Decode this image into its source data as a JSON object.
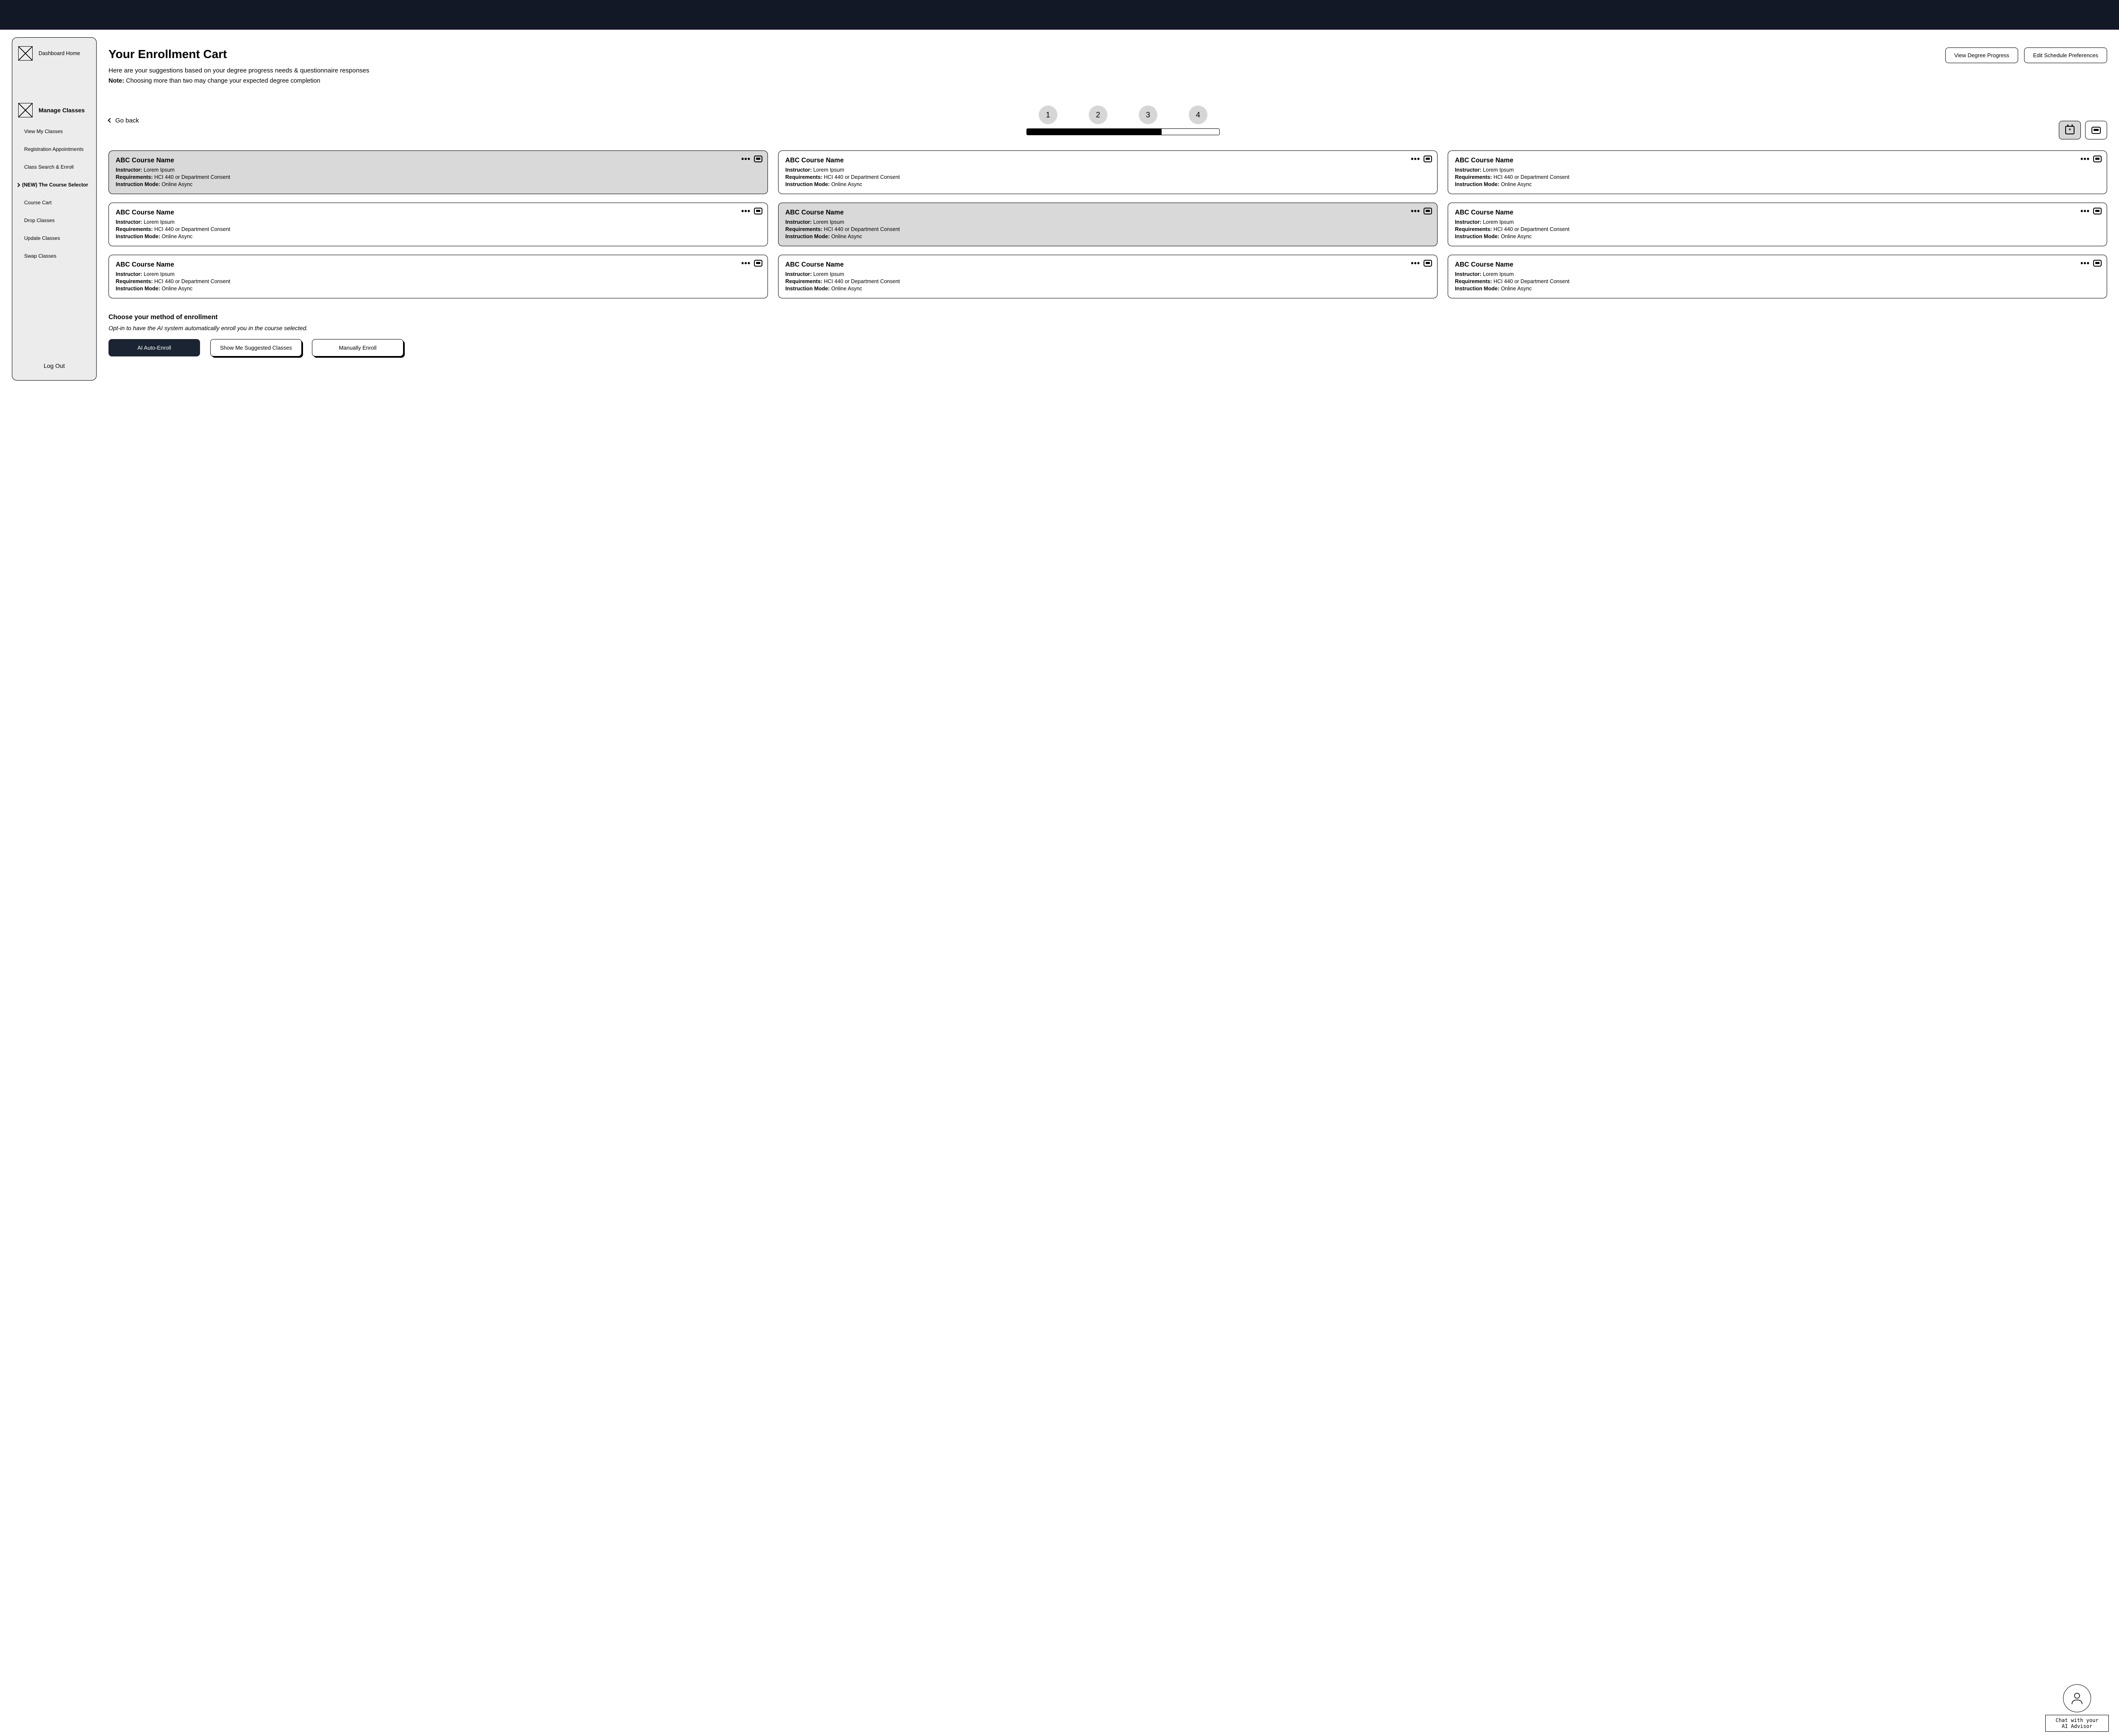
{
  "sidebar": {
    "dashboard_label": "Dashboard Home",
    "manage_label": "Manage Classes",
    "items": [
      "View My Classes",
      "Registration Appointments",
      "Class Search & Enroll",
      "(NEW) The Course Selector",
      "Course Cart",
      "Drop Classes",
      "Update Classes",
      "Swap Classes"
    ],
    "logout_label": "Log Out"
  },
  "header": {
    "title": "Your Enrollment Cart",
    "subtitle": "Here are your suggestions based on your degree progress needs & questionnaire responses",
    "note_label": "Note:",
    "note_text": "Choosing more than two may change your expected degree completion",
    "btn_degree": "View Degree Progress",
    "btn_prefs": "Edit Schedule Preferences"
  },
  "steps": {
    "go_back": "Go back",
    "labels": [
      "1",
      "2",
      "3",
      "4"
    ],
    "progress_percent": 70
  },
  "cards": [
    {
      "title": "ABC Course Name",
      "instructor_label": "Instructor:",
      "instructor": "Lorem Ipsum",
      "req_label": "Requirements:",
      "req": "HCI 440 or Department Consent",
      "mode_label": "Instruction Mode:",
      "mode": "Online Async",
      "selected": true
    },
    {
      "title": "ABC Course Name",
      "instructor_label": "Instructor:",
      "instructor": "Lorem Ipsum",
      "req_label": "Requirements:",
      "req": "HCI 440 or Department Consent",
      "mode_label": "Instruction Mode:",
      "mode": "Online Async",
      "selected": false
    },
    {
      "title": "ABC Course Name",
      "instructor_label": "Instructor:",
      "instructor": "Lorem Ipsum",
      "req_label": "Requirements:",
      "req": "HCI 440 or Department Consent",
      "mode_label": "Instruction Mode:",
      "mode": "Online Async",
      "selected": false
    },
    {
      "title": "ABC Course Name",
      "instructor_label": "Instructor:",
      "instructor": "Lorem Ipsum",
      "req_label": "Requirements:",
      "req": "HCI 440 or Department Consent",
      "mode_label": "Instruction Mode:",
      "mode": "Online Async",
      "selected": false
    },
    {
      "title": "ABC Course Name",
      "instructor_label": "Instructor:",
      "instructor": "Lorem Ipsum",
      "req_label": "Requirements:",
      "req": "HCI 440 or Department Consent",
      "mode_label": "Instruction Mode:",
      "mode": "Online Async",
      "selected": true
    },
    {
      "title": "ABC Course Name",
      "instructor_label": "Instructor:",
      "instructor": "Lorem Ipsum",
      "req_label": "Requirements:",
      "req": "HCI 440 or Department Consent",
      "mode_label": "Instruction Mode:",
      "mode": "Online Async",
      "selected": false
    },
    {
      "title": "ABC Course Name",
      "instructor_label": "Instructor:",
      "instructor": "Lorem Ipsum",
      "req_label": "Requirements:",
      "req": "HCI 440 or Department Consent",
      "mode_label": "Instruction Mode:",
      "mode": "Online Async",
      "selected": false
    },
    {
      "title": "ABC Course Name",
      "instructor_label": "Instructor:",
      "instructor": "Lorem Ipsum",
      "req_label": "Requirements:",
      "req": "HCI 440 or Department Consent",
      "mode_label": "Instruction Mode:",
      "mode": "Online Async",
      "selected": false
    },
    {
      "title": "ABC Course Name",
      "instructor_label": "Instructor:",
      "instructor": "Lorem Ipsum",
      "req_label": "Requirements:",
      "req": "HCI 440 or Department Consent",
      "mode_label": "Instruction Mode:",
      "mode": "Online Async",
      "selected": false
    }
  ],
  "enroll": {
    "heading": "Choose your method of enrollment",
    "subheading": "Opt-in to have the AI system automatically enroll you in the course selected.",
    "btn_auto": "AI Auto-Enroll",
    "btn_suggest": "Show Me Suggested Classes",
    "btn_manual": "Manually Enroll"
  },
  "chat": {
    "label_line1": "Chat with your",
    "label_line2": "AI Advisor"
  }
}
